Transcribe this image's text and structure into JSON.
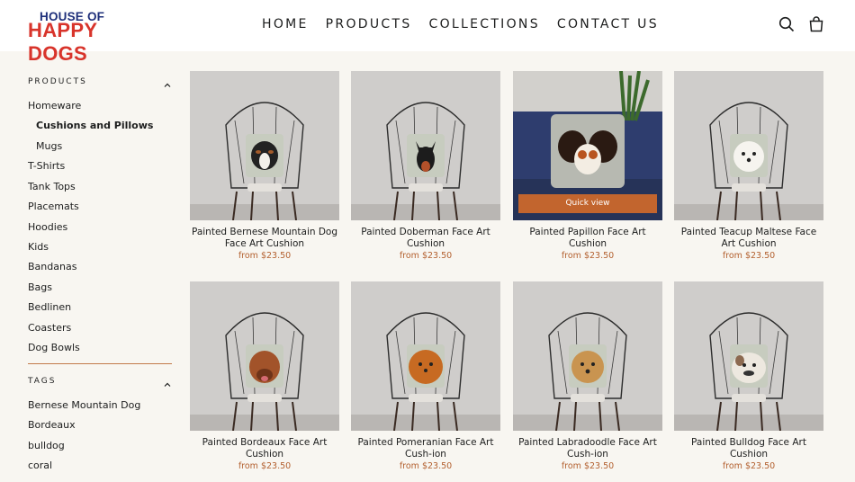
{
  "header": {
    "logo_line1": "HOUSE OF",
    "logo_line2": "HAPPY DOGS",
    "nav": [
      "HOME",
      "PRODUCTS",
      "COLLECTIONS",
      "CONTACT US"
    ],
    "icons": [
      "search-icon",
      "cart-icon"
    ]
  },
  "sidebar": {
    "products_heading": "PRODUCTS",
    "products": [
      {
        "label": "Homeware",
        "active": false,
        "indent": false
      },
      {
        "label": "Cushions and Pillows",
        "active": true,
        "indent": true
      },
      {
        "label": "Mugs",
        "active": false,
        "indent": true
      },
      {
        "label": "T-Shirts",
        "active": false,
        "indent": false
      },
      {
        "label": "Tank Tops",
        "active": false,
        "indent": false
      },
      {
        "label": "Placemats",
        "active": false,
        "indent": false
      },
      {
        "label": "Hoodies",
        "active": false,
        "indent": false
      },
      {
        "label": "Kids",
        "active": false,
        "indent": false
      },
      {
        "label": "Bandanas",
        "active": false,
        "indent": false
      },
      {
        "label": "Bags",
        "active": false,
        "indent": false
      },
      {
        "label": "Bedlinen",
        "active": false,
        "indent": false
      },
      {
        "label": "Coasters",
        "active": false,
        "indent": false
      },
      {
        "label": "Dog Bowls",
        "active": false,
        "indent": false
      }
    ],
    "tags_heading": "TAGS",
    "tags": [
      "Bernese Mountain Dog",
      "Bordeaux",
      "bulldog",
      "coral"
    ]
  },
  "products": [
    {
      "title": "Painted Bernese Mountain Dog Face Art Cushion",
      "price": "from $23.50"
    },
    {
      "title": "Painted Doberman Face Art Cushion",
      "price": "from $23.50"
    },
    {
      "title": "Painted Papillon Face Art Cushion",
      "price": "from $23.50",
      "quick_view": "Quick view"
    },
    {
      "title": "Painted Teacup Maltese Face Art Cushion",
      "price": "from $23.50"
    },
    {
      "title": "Painted Bordeaux Face Art Cushion",
      "price": "from $23.50"
    },
    {
      "title": "Painted Pomeranian Face Art Cush-ion",
      "price": "from $23.50"
    },
    {
      "title": "Painted Labradoodle Face Art Cush-ion",
      "price": "from $23.50"
    },
    {
      "title": "Painted Bulldog Face Art Cushion",
      "price": "from $23.50"
    }
  ],
  "colors": {
    "accent": "#c2652e",
    "price": "#b3602f",
    "logo_blue": "#1e2f7a",
    "logo_red": "#d8342b",
    "background": "#f8f6f1"
  }
}
